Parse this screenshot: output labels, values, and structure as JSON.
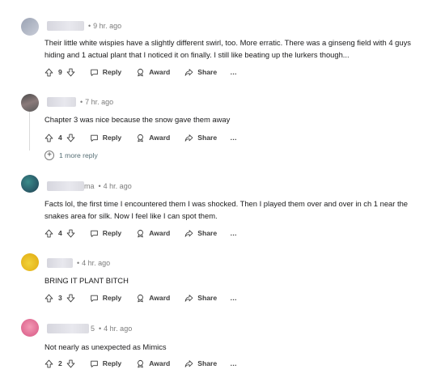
{
  "comments": [
    {
      "username": "",
      "time": "9 hr. ago",
      "body": "Their little white wispies have a slightly different swirl, too. More erratic. There was a ginseng field with 4 guys hiding and 1 actual plant that I noticed it on finally. I still like beating up the lurkers though...",
      "votes": "9",
      "reply_label": "Reply",
      "award_label": "Award",
      "share_label": "Share",
      "more_label": "…"
    },
    {
      "username": "",
      "time": "7 hr. ago",
      "body": "Chapter 3 was nice because the snow gave them away",
      "votes": "4",
      "reply_label": "Reply",
      "award_label": "Award",
      "share_label": "Share",
      "more_label": "…",
      "more_replies": "1 more reply"
    },
    {
      "username": "ma",
      "time": "4 hr. ago",
      "body": "Facts lol, the first time I encountered them I was shocked. Then I played them over and over in ch 1 near the snakes area for silk. Now I feel like I can spot them.",
      "votes": "4",
      "reply_label": "Reply",
      "award_label": "Award",
      "share_label": "Share",
      "more_label": "…"
    },
    {
      "username": "",
      "time": "4 hr. ago",
      "body": "BRING IT PLANT BITCH",
      "votes": "3",
      "reply_label": "Reply",
      "award_label": "Award",
      "share_label": "Share",
      "more_label": "…"
    },
    {
      "username": "5",
      "time": "4 hr. ago",
      "body": "Not nearly as unexpected as Mimics",
      "votes": "2",
      "reply_label": "Reply",
      "award_label": "Award",
      "share_label": "Share",
      "more_label": "…"
    }
  ],
  "icons": {
    "upvote": "upvote-icon",
    "downvote": "downvote-icon",
    "reply": "reply-icon",
    "award": "award-icon",
    "share": "share-icon"
  },
  "colors": {
    "text": "#1a1a1b",
    "meta": "#7c7c7c",
    "action": "#3d3d3d",
    "thread_line": "#dadada"
  }
}
